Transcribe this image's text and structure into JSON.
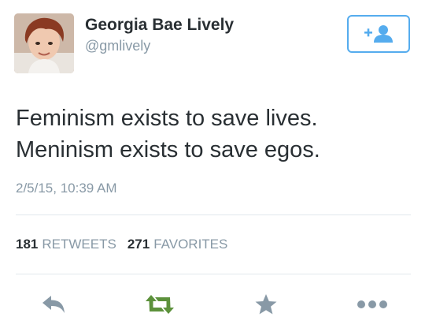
{
  "user": {
    "name": "Georgia Bae Lively",
    "handle": "@gmlively"
  },
  "tweet": {
    "lines": [
      "Feminism exists to save lives.",
      "Meninism exists to save egos."
    ],
    "timestamp": "2/5/15, 10:39 AM"
  },
  "stats": {
    "retweets_count": "181",
    "retweets_label": "RETWEETS",
    "favorites_count": "271",
    "favorites_label": "FAVORITES"
  },
  "icons": {
    "follow": "follow-add-user-icon",
    "reply": "reply-icon",
    "retweet": "retweet-icon",
    "favorite": "star-icon",
    "more": "more-dots-icon"
  },
  "colors": {
    "accent": "#55acee",
    "retweet": "#5c913b",
    "icon_gray": "#8899a6",
    "text": "#292f33"
  }
}
